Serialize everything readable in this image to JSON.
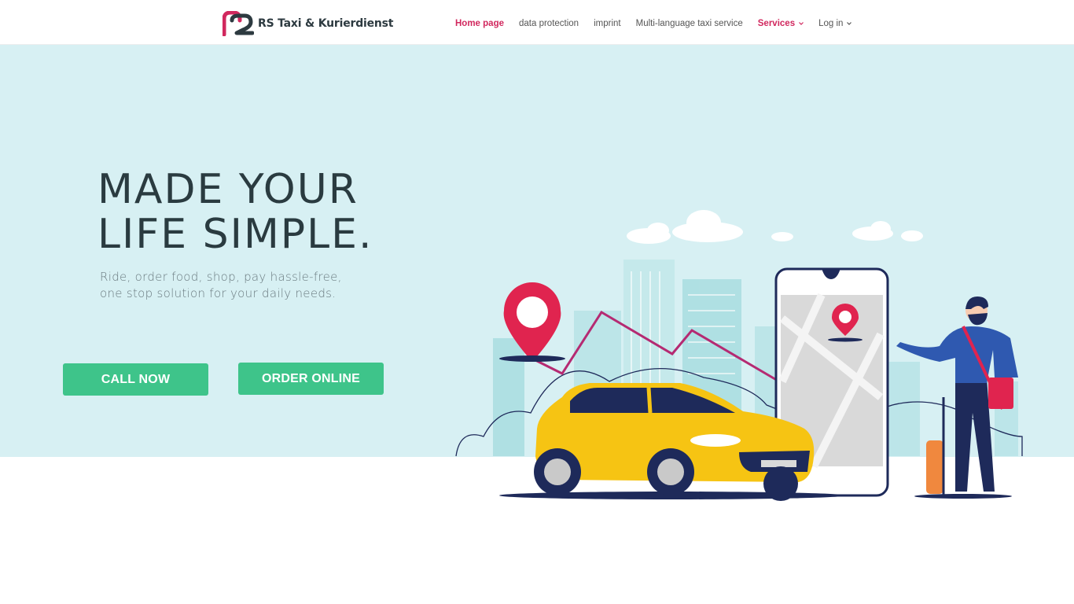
{
  "header": {
    "logo_text": "RS Taxi & Kurierdienst",
    "nav": [
      {
        "label": "Home page"
      },
      {
        "label": "data protection"
      },
      {
        "label": "imprint"
      },
      {
        "label": "Multi-language taxi service"
      },
      {
        "label": "Services"
      },
      {
        "label": "Log in"
      }
    ]
  },
  "hero": {
    "headline_line1": "MADE YOUR",
    "headline_line2": "LIFE SIMPLE.",
    "subtitle_line1": "Ride, order food, shop, pay hassle-free,",
    "subtitle_line2": "one stop solution for your daily needs.",
    "call_button": "CALL NOW",
    "order_button": "ORDER ONLINE"
  },
  "colors": {
    "accent": "#d1285e",
    "button": "#3ec48a",
    "hero_bg": "#d7f0f3",
    "heading": "#2a3b40"
  },
  "icons": [
    "rs-logo-icon",
    "chevron-down-icon",
    "location-pin-icon",
    "taxi-car-illustration",
    "phone-map-illustration",
    "traveler-illustration"
  ]
}
